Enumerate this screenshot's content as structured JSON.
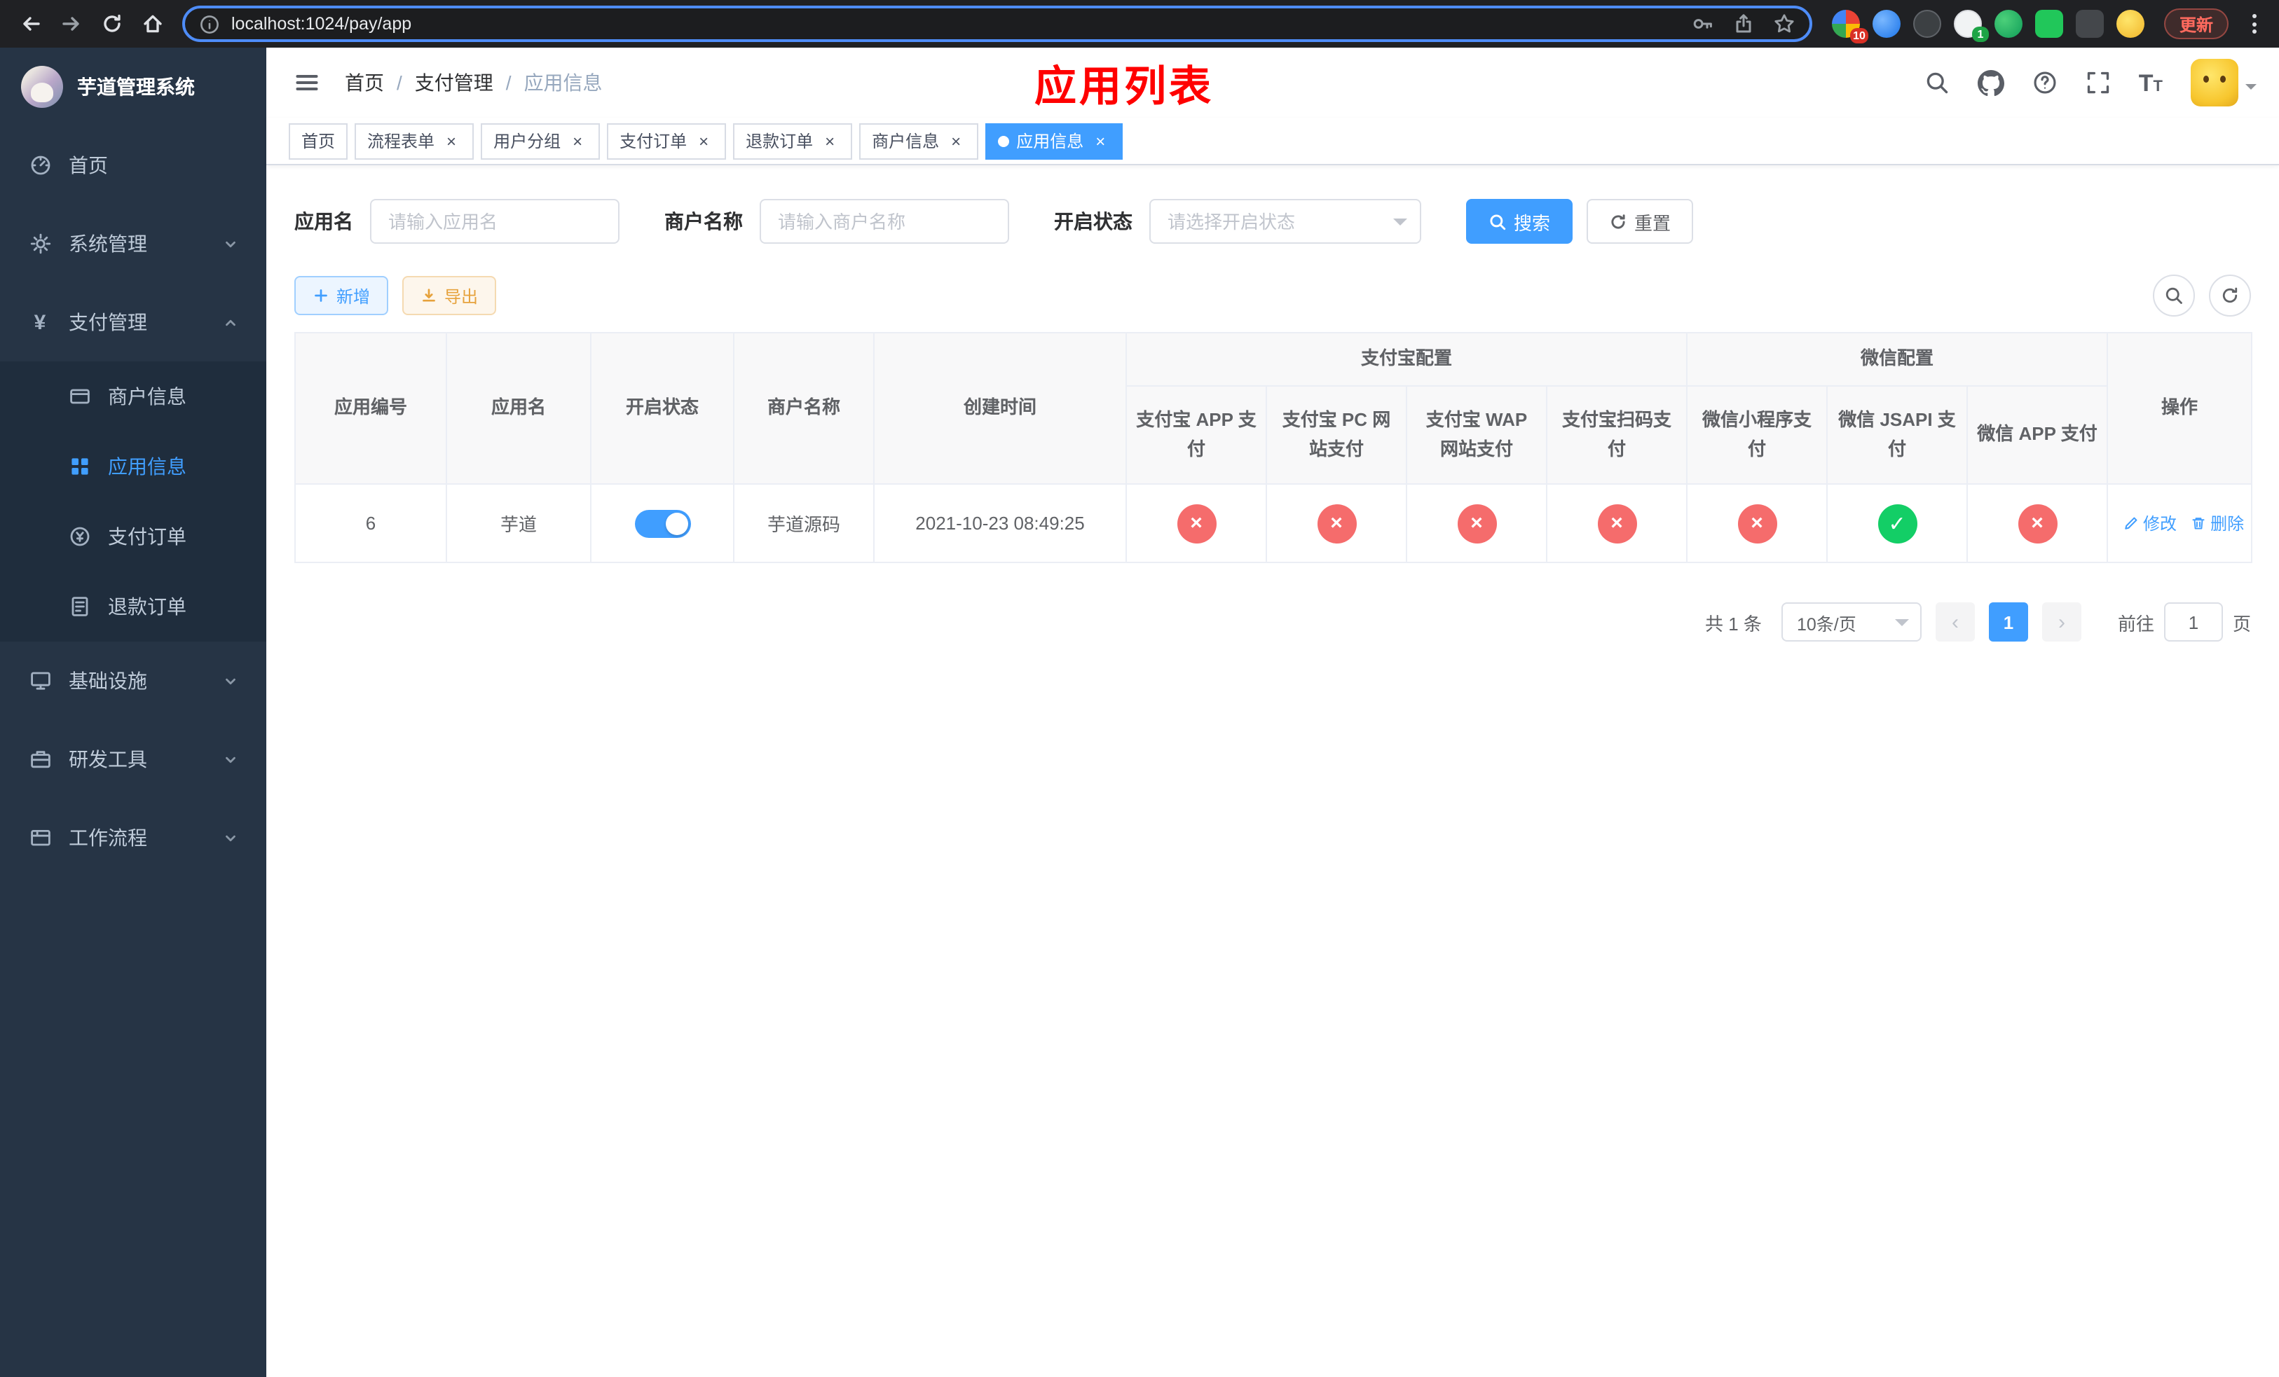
{
  "colors": {
    "primary": "#409eff",
    "danger": "#f56c6c",
    "success": "#13ce66",
    "warning": "#e6a23c",
    "annotation": "#ff0000",
    "sidebar_bg": "#263445",
    "sidebar_sub_bg": "#1f2d3d"
  },
  "browser": {
    "url": "localhost:1024/pay/app",
    "update_label": "更新",
    "ext_badge_red": "10",
    "ext_badge_green": "1"
  },
  "sidebar": {
    "logo_title": "芋道管理系统",
    "items": [
      {
        "label": "首页"
      },
      {
        "label": "系统管理"
      },
      {
        "label": "支付管理",
        "children": [
          {
            "label": "商户信息"
          },
          {
            "label": "应用信息"
          },
          {
            "label": "支付订单"
          },
          {
            "label": "退款订单"
          }
        ]
      },
      {
        "label": "基础设施"
      },
      {
        "label": "研发工具"
      },
      {
        "label": "工作流程"
      }
    ]
  },
  "header": {
    "breadcrumb": [
      "首页",
      "支付管理",
      "应用信息"
    ],
    "separator": "/",
    "annotation": "应用列表"
  },
  "tabs": [
    {
      "label": "首页"
    },
    {
      "label": "流程表单"
    },
    {
      "label": "用户分组"
    },
    {
      "label": "支付订单"
    },
    {
      "label": "退款订单"
    },
    {
      "label": "商户信息"
    },
    {
      "label": "应用信息"
    }
  ],
  "filters": {
    "app_name_label": "应用名",
    "app_name_placeholder": "请输入应用名",
    "merchant_label": "商户名称",
    "merchant_placeholder": "请输入商户名称",
    "status_label": "开启状态",
    "status_placeholder": "请选择开启状态",
    "search_label": "搜索",
    "reset_label": "重置"
  },
  "toolbar": {
    "add_label": "新增",
    "export_label": "导出"
  },
  "table": {
    "headers": {
      "id": "应用编号",
      "name": "应用名",
      "status": "开启状态",
      "merchant": "商户名称",
      "created": "创建时间",
      "alipay_group": "支付宝配置",
      "wechat_group": "微信配置",
      "actions": "操作",
      "sub": [
        "支付宝 APP 支付",
        "支付宝 PC 网站支付",
        "支付宝 WAP 网站支付",
        "支付宝扫码支付",
        "微信小程序支付",
        "微信 JSAPI 支付",
        "微信 APP 支付"
      ]
    },
    "rows": [
      {
        "id": "6",
        "name": "芋道",
        "status_on": true,
        "merchant": "芋道源码",
        "created": "2021-10-23 08:49:25",
        "configs": [
          false,
          false,
          false,
          false,
          false,
          true,
          false
        ],
        "edit_label": "修改",
        "delete_label": "删除"
      }
    ]
  },
  "pagination": {
    "total": "共 1 条",
    "page_size": "10条/页",
    "page": "1",
    "goto_label": "前往",
    "goto_value": "1",
    "goto_suffix": "页"
  }
}
